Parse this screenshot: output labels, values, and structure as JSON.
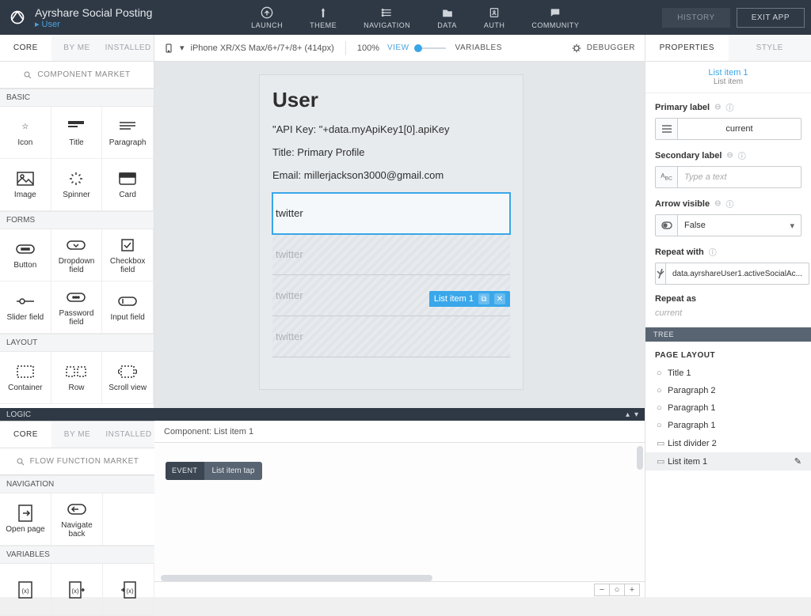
{
  "topbar": {
    "app_title": "Ayrshare Social Posting",
    "breadcrumb": "User",
    "nav": {
      "launch": "LAUNCH",
      "theme": "THEME",
      "navigation": "NAVIGATION",
      "data": "DATA",
      "auth": "AUTH",
      "community": "COMMUNITY"
    },
    "history_btn": "HISTORY",
    "exit_btn": "EXIT APP"
  },
  "canvas_header": {
    "device": "iPhone XR/XS Max/6+/7+/8+ (414px)",
    "zoom": "100%",
    "preview": "VIEW",
    "variables": "VARIABLES",
    "debugger": "DEBUGGER"
  },
  "left": {
    "tabs": {
      "core": "CORE",
      "byme": "BY ME",
      "installed": "INSTALLED"
    },
    "search": "COMPONENT MARKET",
    "sections": {
      "basic": "BASIC",
      "forms": "FORMS",
      "layout": "LAYOUT"
    },
    "basic": [
      "Icon",
      "Title",
      "Paragraph",
      "Image",
      "Spinner",
      "Card"
    ],
    "forms": [
      "Button",
      "Dropdown field",
      "Checkbox field",
      "Slider field",
      "Password field",
      "Input field"
    ],
    "layout": [
      "Container",
      "Row",
      "Scroll view"
    ]
  },
  "logic_bar": {
    "label": "LOGIC"
  },
  "left_lower": {
    "tabs": {
      "core": "CORE",
      "byme": "BY ME",
      "installed": "INSTALLED"
    },
    "search": "FLOW FUNCTION MARKET",
    "sections": {
      "nav": "NAVIGATION",
      "vars": "VARIABLES"
    },
    "nav": [
      "Open page",
      "Navigate back"
    ]
  },
  "device": {
    "title": "User",
    "line1": "\"API Key: \"+data.myApiKey1[0].apiKey",
    "line2": "Title: Primary Profile",
    "line3": "Email: millerjackson3000@gmail.com",
    "sel_tag": "List item 1",
    "list": [
      "twitter",
      "twitter",
      "twitter",
      "twitter"
    ]
  },
  "logic_canvas": {
    "header": "Component: List item 1",
    "event_label": "EVENT",
    "event_value": "List item tap"
  },
  "right": {
    "tabs": {
      "props": "PROPERTIES",
      "style": "STYLE"
    },
    "ident_name": "List item 1",
    "ident_type": "List item",
    "primary_label": {
      "label": "Primary label",
      "value": "current"
    },
    "secondary_label": {
      "label": "Secondary label",
      "placeholder": "Type a text"
    },
    "arrow_visible": {
      "label": "Arrow visible",
      "value": "False"
    },
    "repeat_with": {
      "label": "Repeat with",
      "value": "data.ayrshareUser1.activeSocialAc..."
    },
    "repeat_as": {
      "label": "Repeat as",
      "value": "current"
    },
    "tree_head": "TREE",
    "tree_title": "PAGE LAYOUT",
    "tree": [
      {
        "icon": "○",
        "label": "Title 1"
      },
      {
        "icon": "○",
        "label": "Paragraph 2"
      },
      {
        "icon": "○",
        "label": "Paragraph 1"
      },
      {
        "icon": "○",
        "label": "Paragraph 1"
      },
      {
        "icon": "▭",
        "label": "List divider 2"
      },
      {
        "icon": "▭",
        "label": "List item 1",
        "selected": true
      }
    ]
  }
}
